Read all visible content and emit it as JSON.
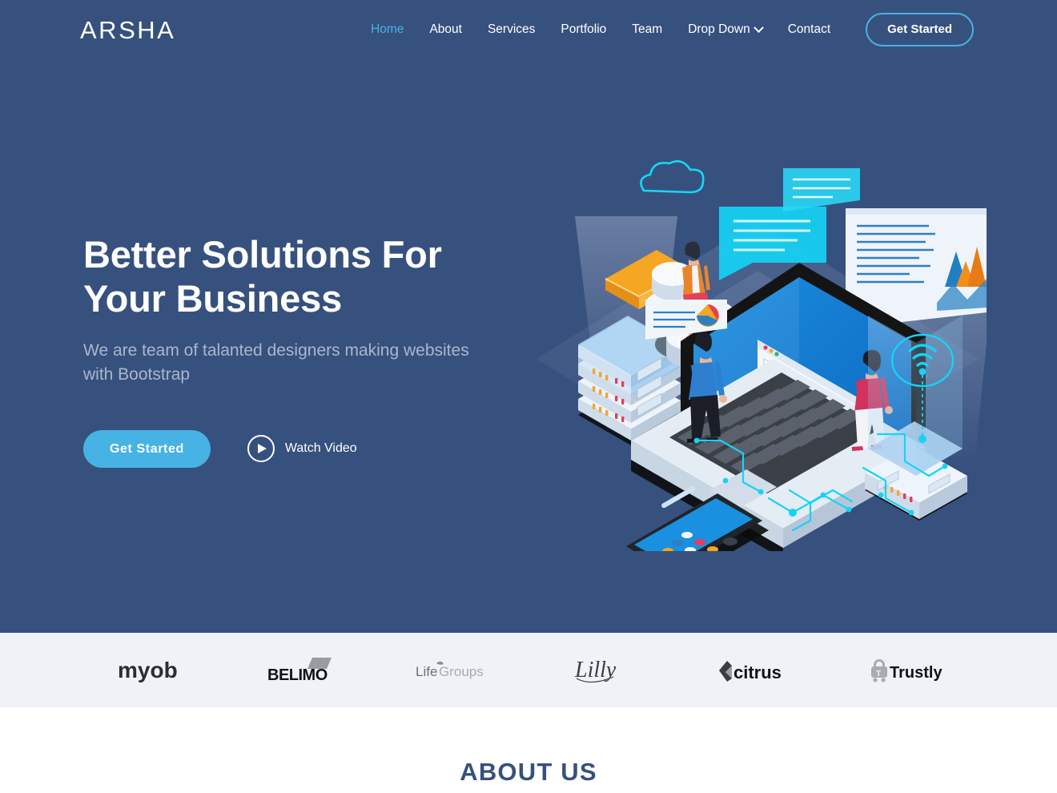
{
  "header": {
    "logo": "ARSHA",
    "nav_items": [
      {
        "label": "Home",
        "active": true,
        "has_caret": false
      },
      {
        "label": "About",
        "active": false,
        "has_caret": false
      },
      {
        "label": "Services",
        "active": false,
        "has_caret": false
      },
      {
        "label": "Portfolio",
        "active": false,
        "has_caret": false
      },
      {
        "label": "Team",
        "active": false,
        "has_caret": false
      },
      {
        "label": "Drop Down",
        "active": false,
        "has_caret": true
      },
      {
        "label": "Contact",
        "active": false,
        "has_caret": false
      }
    ],
    "cta_label": "Get Started"
  },
  "hero": {
    "title_line1": "Better Solutions For",
    "title_line2": "Your Business",
    "subtitle": "We are team of talanted designers making websites with Bootstrap",
    "primary_button": "Get Started",
    "video_label": "Watch Video",
    "illustration_name": "isometric-digital-workspace-illustration"
  },
  "clients": {
    "logos": [
      {
        "name": "myob",
        "label": "myob"
      },
      {
        "name": "belimo",
        "label": "BELIMO"
      },
      {
        "name": "lifegroups",
        "label": "LifeGroups"
      },
      {
        "name": "lilly",
        "label": "Lilly"
      },
      {
        "name": "citrus",
        "label": "citrus"
      },
      {
        "name": "trustly",
        "label": "Trustly"
      }
    ]
  },
  "about": {
    "title": "ABOUT US"
  },
  "colors": {
    "hero_background": "#37517e",
    "accent": "#47b2e4",
    "clients_background": "#f1f2f8",
    "subtitle_text": "#aab6cd",
    "heading_dark": "#37517e"
  }
}
